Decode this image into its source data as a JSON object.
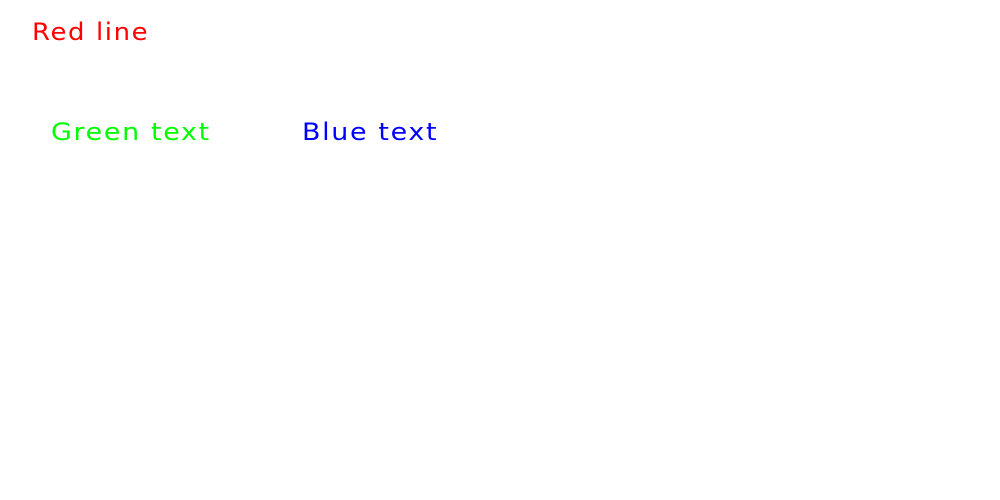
{
  "lines": [
    {
      "text": "Red line",
      "color": "#ff0000"
    },
    {
      "text": "Green text",
      "color": "#00ff00"
    },
    {
      "text": "Blue text",
      "color": "#0000ff"
    }
  ]
}
